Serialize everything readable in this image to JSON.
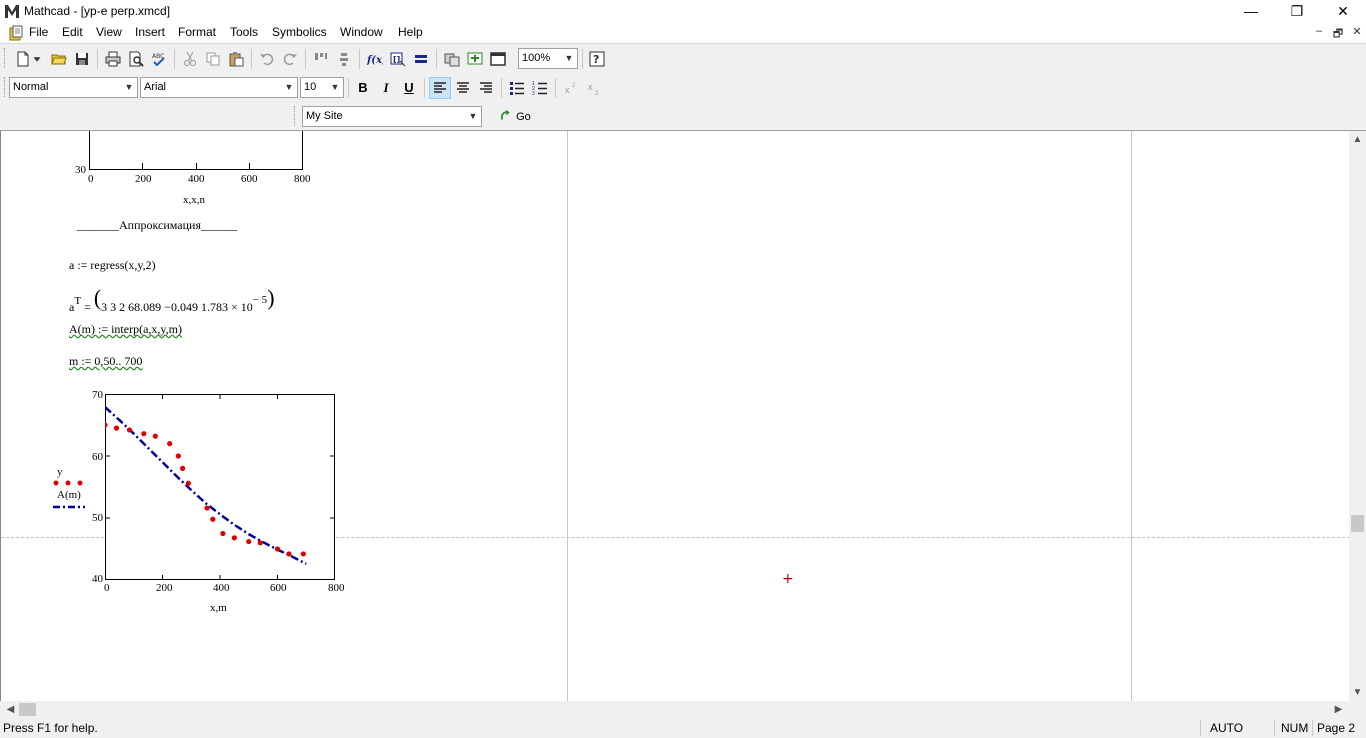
{
  "window": {
    "title": "Mathcad - [yp-e perp.xmcd]",
    "minimize": "—",
    "restore": "❐",
    "close": "✕"
  },
  "menu": [
    {
      "label": "File"
    },
    {
      "label": "Edit"
    },
    {
      "label": "View"
    },
    {
      "label": "Insert"
    },
    {
      "label": "Format"
    },
    {
      "label": "Tools"
    },
    {
      "label": "Symbolics"
    },
    {
      "label": "Window"
    },
    {
      "label": "Help"
    }
  ],
  "mdi": {
    "minimize": "–",
    "restore": "🗗",
    "close": "✕"
  },
  "toolbar": {
    "zoom": "100%"
  },
  "format_bar": {
    "style": "Normal",
    "font": "Arial",
    "size": "10",
    "bold": "B",
    "italic": "I",
    "underline": "U"
  },
  "web_bar": {
    "site": "My Site",
    "go": "Go"
  },
  "doc": {
    "plot1": {
      "y_min_label": "30",
      "x_ticks": [
        "0",
        "200",
        "400",
        "600",
        "800"
      ],
      "x_label": "x,x,n"
    },
    "heading": "_______Аппроксимация______",
    "eq1": "a := regress(x,y,2)",
    "eq2_prefix": "a",
    "eq2_sup": "T",
    "eq2_eq": " = ",
    "eq2_vals": "3   3   2   68.089   −0.049   1.783 × 10",
    "eq2_exp": "− 5",
    "eq3": "A(m) := interp(a,x,y,m)",
    "eq4": "m := 0,50.. 700",
    "plot2": {
      "y_ticks": [
        "70",
        "60",
        "50",
        "40"
      ],
      "x_ticks": [
        "0",
        "200",
        "400",
        "600",
        "800"
      ],
      "legend_y": "y",
      "legend_a": "A(m)",
      "x_label": "x,m"
    }
  },
  "chart_data": {
    "type": "scatter",
    "xlabel": "x,m",
    "xlim": [
      0,
      800
    ],
    "ylim": [
      40,
      70
    ],
    "series": [
      {
        "name": "y",
        "style": "points",
        "color": "#e00000",
        "x": [
          0,
          40,
          85,
          135,
          175,
          225,
          255,
          270,
          290,
          355,
          375,
          410,
          450,
          500,
          540,
          600,
          640,
          690
        ],
        "y": [
          65,
          64.5,
          64.2,
          63.6,
          63.2,
          62,
          60,
          58,
          55.6,
          51.6,
          49.8,
          47.5,
          46.8,
          46.2,
          46,
          45,
          44.2,
          44.2
        ]
      },
      {
        "name": "A(m)",
        "style": "dash-dot",
        "color": "#00009a",
        "x": [
          0,
          50,
          100,
          150,
          200,
          250,
          300,
          350,
          400,
          450,
          500,
          550,
          600,
          650,
          700
        ],
        "y": [
          67.9,
          65.8,
          63.6,
          61.3,
          59,
          56.7,
          54.5,
          52.4,
          50.6,
          48.9,
          47.4,
          46.1,
          44.9,
          43.8,
          42.6
        ]
      }
    ]
  },
  "status": {
    "help": "Press F1 for help.",
    "auto": "AUTO",
    "num": "NUM",
    "page": "Page 2"
  }
}
